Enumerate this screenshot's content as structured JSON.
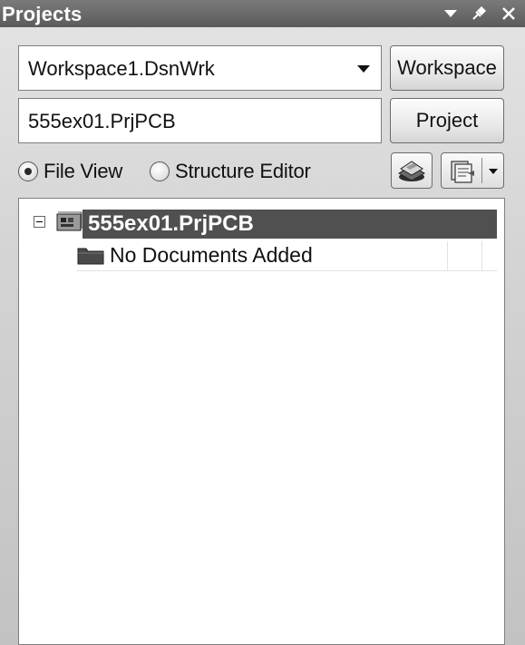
{
  "panel": {
    "title": "Projects",
    "title_controls": [
      "menu-arrow-icon",
      "pin-icon",
      "close-icon"
    ]
  },
  "workspace": {
    "selected": "Workspace1.DsnWrk",
    "button_label": "Workspace"
  },
  "project": {
    "value": "555ex01.PrjPCB",
    "button_label": "Project"
  },
  "view_mode": {
    "options": [
      {
        "label": "File View",
        "checked": true
      },
      {
        "label": "Structure Editor",
        "checked": false
      }
    ]
  },
  "toolbar_icons": [
    "compile-icon",
    "documents-dropdown-icon"
  ],
  "tree": {
    "project_name": "555ex01.PrjPCB",
    "project_icon": "pcb-project-icon",
    "expander_state": "expanded",
    "children": [
      {
        "label": "No Documents Added",
        "icon": "folder-icon"
      }
    ]
  },
  "colors": {
    "titlebar": "#5e5e5e",
    "selected_row": "#505050"
  }
}
